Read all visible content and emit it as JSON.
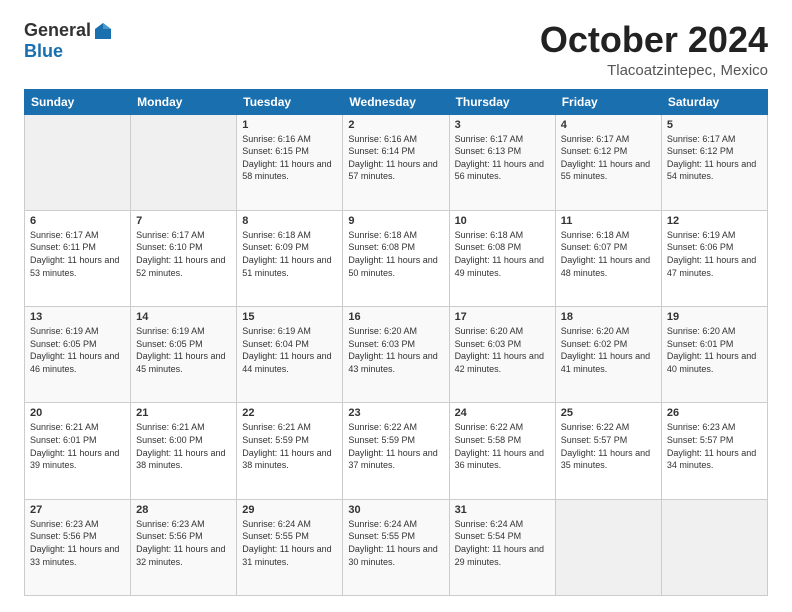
{
  "header": {
    "logo_general": "General",
    "logo_blue": "Blue",
    "month_title": "October 2024",
    "location": "Tlacoatzintepec, Mexico"
  },
  "days_of_week": [
    "Sunday",
    "Monday",
    "Tuesday",
    "Wednesday",
    "Thursday",
    "Friday",
    "Saturday"
  ],
  "weeks": [
    [
      {
        "day": "",
        "info": ""
      },
      {
        "day": "",
        "info": ""
      },
      {
        "day": "1",
        "info": "Sunrise: 6:16 AM\nSunset: 6:15 PM\nDaylight: 11 hours and 58 minutes."
      },
      {
        "day": "2",
        "info": "Sunrise: 6:16 AM\nSunset: 6:14 PM\nDaylight: 11 hours and 57 minutes."
      },
      {
        "day": "3",
        "info": "Sunrise: 6:17 AM\nSunset: 6:13 PM\nDaylight: 11 hours and 56 minutes."
      },
      {
        "day": "4",
        "info": "Sunrise: 6:17 AM\nSunset: 6:12 PM\nDaylight: 11 hours and 55 minutes."
      },
      {
        "day": "5",
        "info": "Sunrise: 6:17 AM\nSunset: 6:12 PM\nDaylight: 11 hours and 54 minutes."
      }
    ],
    [
      {
        "day": "6",
        "info": "Sunrise: 6:17 AM\nSunset: 6:11 PM\nDaylight: 11 hours and 53 minutes."
      },
      {
        "day": "7",
        "info": "Sunrise: 6:17 AM\nSunset: 6:10 PM\nDaylight: 11 hours and 52 minutes."
      },
      {
        "day": "8",
        "info": "Sunrise: 6:18 AM\nSunset: 6:09 PM\nDaylight: 11 hours and 51 minutes."
      },
      {
        "day": "9",
        "info": "Sunrise: 6:18 AM\nSunset: 6:08 PM\nDaylight: 11 hours and 50 minutes."
      },
      {
        "day": "10",
        "info": "Sunrise: 6:18 AM\nSunset: 6:08 PM\nDaylight: 11 hours and 49 minutes."
      },
      {
        "day": "11",
        "info": "Sunrise: 6:18 AM\nSunset: 6:07 PM\nDaylight: 11 hours and 48 minutes."
      },
      {
        "day": "12",
        "info": "Sunrise: 6:19 AM\nSunset: 6:06 PM\nDaylight: 11 hours and 47 minutes."
      }
    ],
    [
      {
        "day": "13",
        "info": "Sunrise: 6:19 AM\nSunset: 6:05 PM\nDaylight: 11 hours and 46 minutes."
      },
      {
        "day": "14",
        "info": "Sunrise: 6:19 AM\nSunset: 6:05 PM\nDaylight: 11 hours and 45 minutes."
      },
      {
        "day": "15",
        "info": "Sunrise: 6:19 AM\nSunset: 6:04 PM\nDaylight: 11 hours and 44 minutes."
      },
      {
        "day": "16",
        "info": "Sunrise: 6:20 AM\nSunset: 6:03 PM\nDaylight: 11 hours and 43 minutes."
      },
      {
        "day": "17",
        "info": "Sunrise: 6:20 AM\nSunset: 6:03 PM\nDaylight: 11 hours and 42 minutes."
      },
      {
        "day": "18",
        "info": "Sunrise: 6:20 AM\nSunset: 6:02 PM\nDaylight: 11 hours and 41 minutes."
      },
      {
        "day": "19",
        "info": "Sunrise: 6:20 AM\nSunset: 6:01 PM\nDaylight: 11 hours and 40 minutes."
      }
    ],
    [
      {
        "day": "20",
        "info": "Sunrise: 6:21 AM\nSunset: 6:01 PM\nDaylight: 11 hours and 39 minutes."
      },
      {
        "day": "21",
        "info": "Sunrise: 6:21 AM\nSunset: 6:00 PM\nDaylight: 11 hours and 38 minutes."
      },
      {
        "day": "22",
        "info": "Sunrise: 6:21 AM\nSunset: 5:59 PM\nDaylight: 11 hours and 38 minutes."
      },
      {
        "day": "23",
        "info": "Sunrise: 6:22 AM\nSunset: 5:59 PM\nDaylight: 11 hours and 37 minutes."
      },
      {
        "day": "24",
        "info": "Sunrise: 6:22 AM\nSunset: 5:58 PM\nDaylight: 11 hours and 36 minutes."
      },
      {
        "day": "25",
        "info": "Sunrise: 6:22 AM\nSunset: 5:57 PM\nDaylight: 11 hours and 35 minutes."
      },
      {
        "day": "26",
        "info": "Sunrise: 6:23 AM\nSunset: 5:57 PM\nDaylight: 11 hours and 34 minutes."
      }
    ],
    [
      {
        "day": "27",
        "info": "Sunrise: 6:23 AM\nSunset: 5:56 PM\nDaylight: 11 hours and 33 minutes."
      },
      {
        "day": "28",
        "info": "Sunrise: 6:23 AM\nSunset: 5:56 PM\nDaylight: 11 hours and 32 minutes."
      },
      {
        "day": "29",
        "info": "Sunrise: 6:24 AM\nSunset: 5:55 PM\nDaylight: 11 hours and 31 minutes."
      },
      {
        "day": "30",
        "info": "Sunrise: 6:24 AM\nSunset: 5:55 PM\nDaylight: 11 hours and 30 minutes."
      },
      {
        "day": "31",
        "info": "Sunrise: 6:24 AM\nSunset: 5:54 PM\nDaylight: 11 hours and 29 minutes."
      },
      {
        "day": "",
        "info": ""
      },
      {
        "day": "",
        "info": ""
      }
    ]
  ]
}
